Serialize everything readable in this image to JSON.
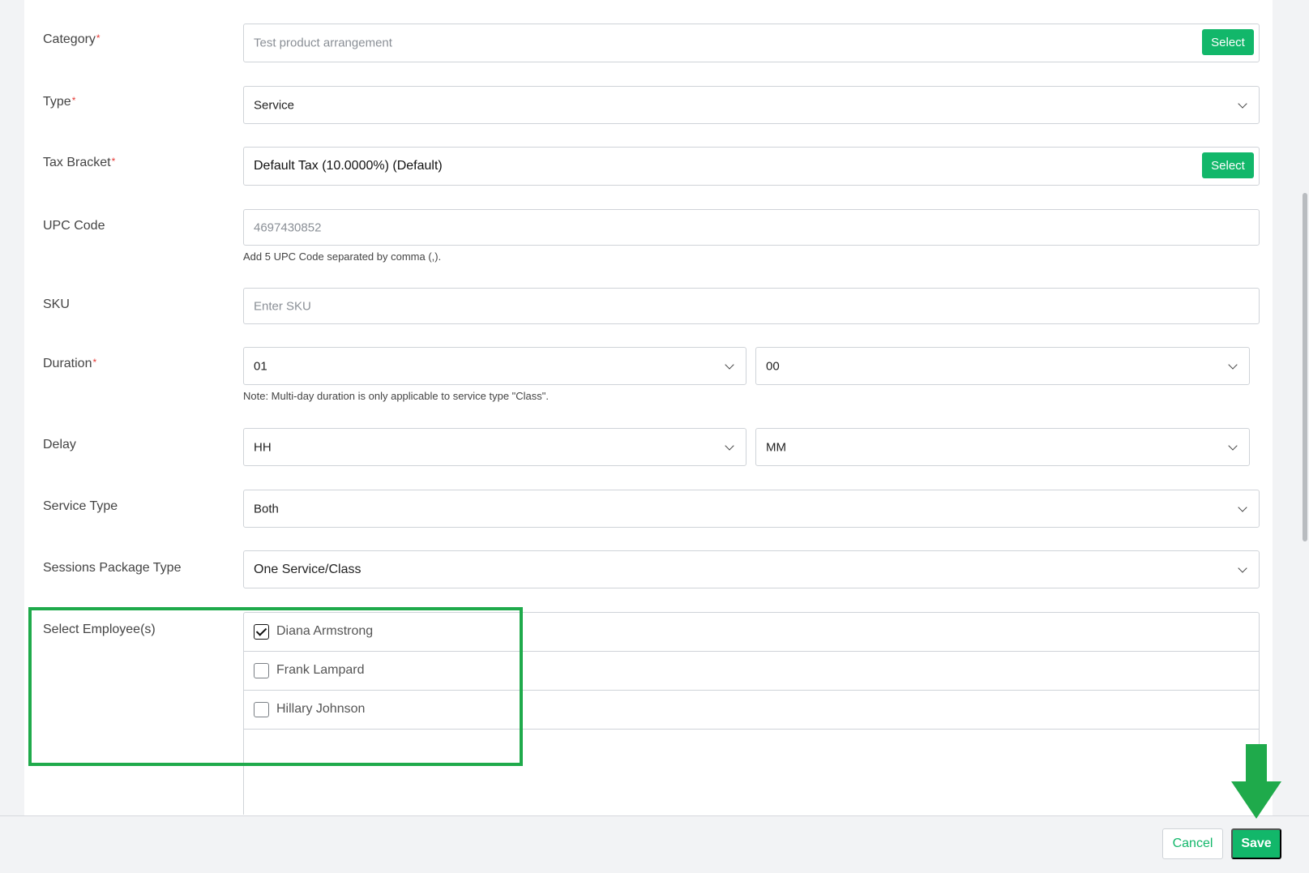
{
  "form": {
    "category": {
      "label": "Category",
      "value": "Test product arrangement",
      "button": "Select"
    },
    "type": {
      "label": "Type",
      "value": "Service"
    },
    "tax_bracket": {
      "label": "Tax Bracket",
      "value": "Default Tax (10.0000%) (Default)",
      "button": "Select"
    },
    "upc_code": {
      "label": "UPC Code",
      "value": "4697430852",
      "hint": "Add 5 UPC Code separated by comma (,)."
    },
    "sku": {
      "label": "SKU",
      "placeholder": "Enter SKU"
    },
    "duration": {
      "label": "Duration",
      "hours": "01",
      "minutes": "00",
      "note": "Note: Multi-day duration is only applicable to service type \"Class\"."
    },
    "delay": {
      "label": "Delay",
      "hours": "HH",
      "minutes": "MM"
    },
    "service_type": {
      "label": "Service Type",
      "value": "Both"
    },
    "sessions_package_type": {
      "label": "Sessions Package Type",
      "value": "One Service/Class"
    },
    "employees": {
      "label": "Select Employee(s)",
      "items": [
        {
          "name": "Diana Armstrong",
          "checked": true
        },
        {
          "name": "Frank Lampard",
          "checked": false
        },
        {
          "name": "Hillary Johnson",
          "checked": false
        }
      ]
    },
    "required_marker": "*"
  },
  "footer": {
    "cancel_label": "Cancel",
    "save_label": "Save"
  },
  "colors": {
    "accent": "#12b76a",
    "highlight": "#1faa4b",
    "required": "#e53935"
  }
}
